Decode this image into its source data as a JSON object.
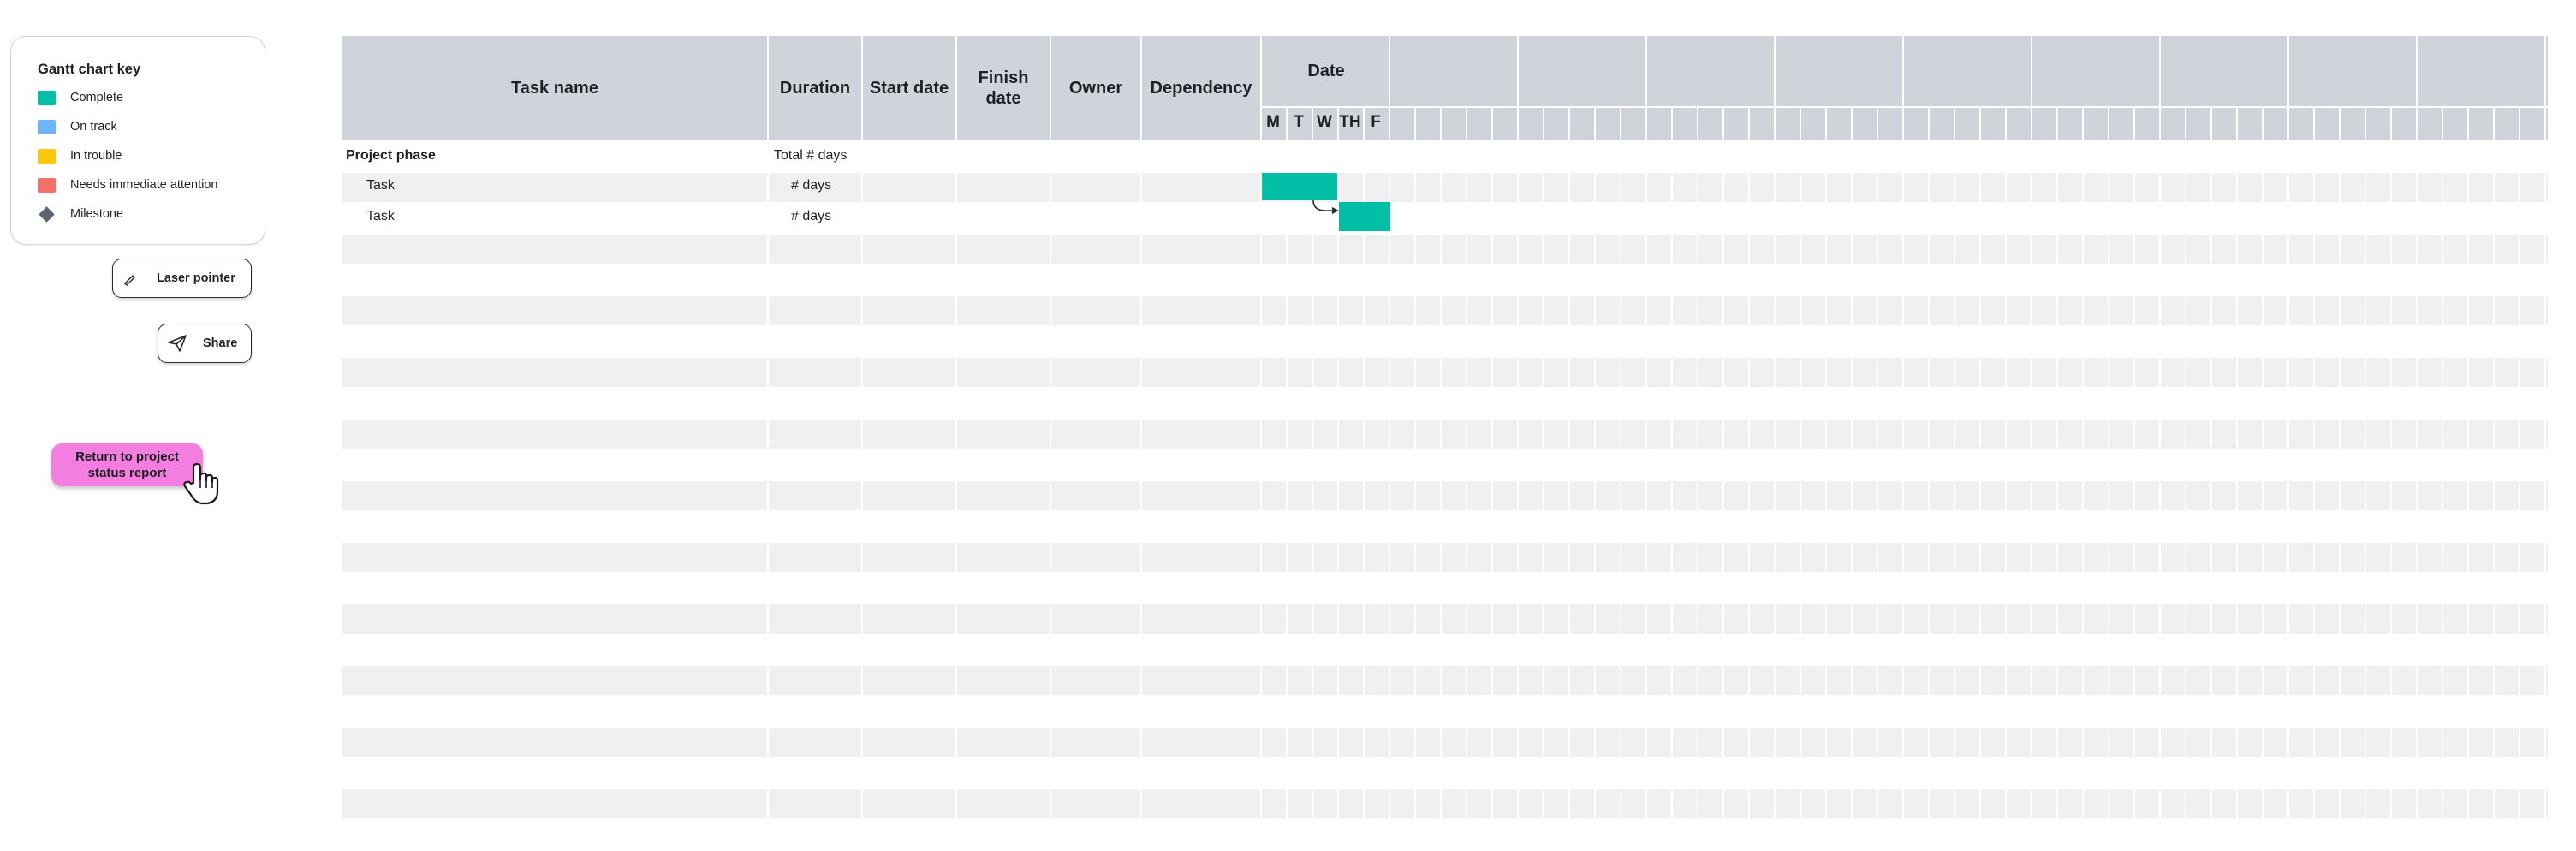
{
  "key": {
    "title": "Gantt chart key",
    "items": [
      {
        "label": "Complete",
        "color": "#00bfa6",
        "shape": "square"
      },
      {
        "label": "On track",
        "color": "#6fb3f8",
        "shape": "square"
      },
      {
        "label": "In trouble",
        "color": "#fdc70e",
        "shape": "square"
      },
      {
        "label": "Needs immediate attention",
        "color": "#f1726b",
        "shape": "square"
      },
      {
        "label": "Milestone",
        "color": "#5f6570",
        "shape": "diamond"
      }
    ]
  },
  "buttons": {
    "laser_pointer": "Laser pointer",
    "share": "Share",
    "return_line1": "Return to project",
    "return_line2": "status report",
    "return_color": "#f47ee0"
  },
  "table": {
    "headers": {
      "task_name": "Task name",
      "duration": "Duration",
      "start_date": "Start date",
      "finish_date": "Finish date",
      "owner": "Owner",
      "dependency": "Dependency",
      "date": "Date"
    },
    "days": [
      "M",
      "T",
      "W",
      "TH",
      "F"
    ],
    "rows": [
      {
        "task": "Project phase",
        "duration": "Total # days",
        "bold": true
      },
      {
        "task": "Task",
        "duration": "# days",
        "bold": false
      },
      {
        "task": "Task",
        "duration": "# days",
        "bold": false
      }
    ],
    "bar_color": "#00bfa6",
    "header_color": "#cfd3da"
  }
}
